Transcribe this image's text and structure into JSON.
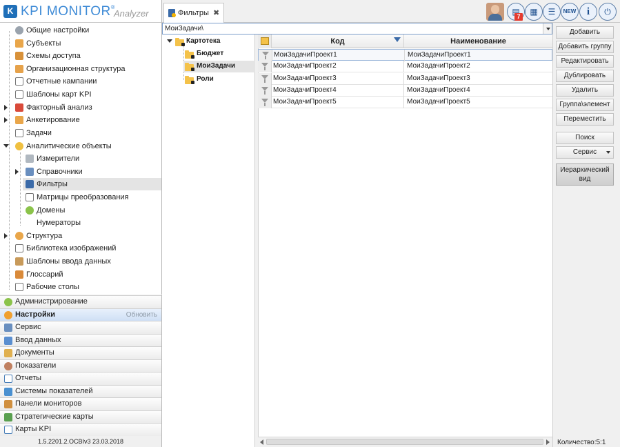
{
  "app": {
    "logo_mark": "K",
    "logo_text": "KPI MONITOR",
    "logo_reg": "®",
    "logo_sub": "Analyzer",
    "version": "1.5.2201.2.OCBIv3  23.03.2018"
  },
  "tabs": [
    {
      "label": "Фильтры",
      "close": "✖"
    }
  ],
  "toolbar": {
    "badge_count": "7",
    "buttons": [
      {
        "icon": "notes-icon",
        "glyph": "▤"
      },
      {
        "icon": "grid-icon",
        "glyph": "▦"
      },
      {
        "icon": "list-icon",
        "glyph": "☰"
      },
      {
        "icon": "new-icon",
        "glyph": "NEW"
      },
      {
        "icon": "info-icon",
        "glyph": "i"
      },
      {
        "icon": "power-icon",
        "glyph": "⏻"
      }
    ]
  },
  "nav": {
    "items": [
      {
        "label": "Общие настройки",
        "icon": "gear-icon"
      },
      {
        "label": "Субъекты",
        "icon": "users-icon"
      },
      {
        "label": "Схемы доступа",
        "icon": "access-icon"
      },
      {
        "label": "Организационная структура",
        "icon": "org-icon"
      },
      {
        "label": "Отчетные кампании",
        "icon": "campaign-icon"
      },
      {
        "label": "Шаблоны карт KPI",
        "icon": "template-icon"
      },
      {
        "label": "Факторный анализ",
        "icon": "factor-icon"
      },
      {
        "label": "Анкетирование",
        "icon": "survey-icon"
      },
      {
        "label": "Задачи",
        "icon": "tasks-icon"
      },
      {
        "label": "Аналитические объекты",
        "icon": "analytics-icon"
      },
      {
        "label": "Измерители",
        "icon": "gauge-icon"
      },
      {
        "label": "Справочники",
        "icon": "reference-icon"
      },
      {
        "label": "Фильтры",
        "icon": "filter-icon"
      },
      {
        "label": "Матрицы преобразования",
        "icon": "matrix-icon"
      },
      {
        "label": "Домены",
        "icon": "domain-icon"
      },
      {
        "label": "Нумераторы",
        "icon": ""
      },
      {
        "label": "Структура",
        "icon": "structure-icon"
      },
      {
        "label": "Библиотека изображений",
        "icon": "images-icon"
      },
      {
        "label": "Шаблоны ввода данных",
        "icon": "input-template-icon"
      },
      {
        "label": "Глоссарий",
        "icon": "glossary-icon"
      },
      {
        "label": "Рабочие столы",
        "icon": "desktop-icon"
      }
    ]
  },
  "sections": [
    {
      "label": "Администрирование",
      "icon": "admin-icon",
      "color": "#8bc34a"
    },
    {
      "label": "Настройки",
      "icon": "settings-icon",
      "color": "#f0a030",
      "active": true,
      "action": "Обновить"
    },
    {
      "label": "Сервис",
      "icon": "service-icon",
      "color": "#6a8fbf"
    },
    {
      "label": "Ввод данных",
      "icon": "data-input-icon",
      "color": "#5b8fd0"
    },
    {
      "label": "Документы",
      "icon": "documents-icon",
      "color": "#e0b050"
    },
    {
      "label": "Показатели",
      "icon": "indicators-icon",
      "color": "#c08060"
    },
    {
      "label": "Отчеты",
      "icon": "reports-icon",
      "color": "#4a7fb8"
    },
    {
      "label": "Системы показателей",
      "icon": "systems-icon",
      "color": "#4a90d0"
    },
    {
      "label": "Панели мониторов",
      "icon": "dashboards-icon",
      "color": "#d09040"
    },
    {
      "label": "Стратегические карты",
      "icon": "strategy-icon",
      "color": "#5aa050"
    },
    {
      "label": "Карты KPI",
      "icon": "kpi-icon",
      "color": "#4a7fb8"
    }
  ],
  "path": {
    "value": "МоиЗадачи\\"
  },
  "tree": {
    "root": "Картотека",
    "children": [
      "Бюджет",
      "МоиЗадачи",
      "Роли"
    ]
  },
  "grid": {
    "columns": [
      "Код",
      "Наименование"
    ],
    "rows": [
      {
        "code": "МоиЗадачиПроект1",
        "name": "МоиЗадачиПроект1"
      },
      {
        "code": "МоиЗадачиПроект2",
        "name": "МоиЗадачиПроект2"
      },
      {
        "code": "МоиЗадачиПроект3",
        "name": "МоиЗадачиПроект3"
      },
      {
        "code": "МоиЗадачиПроект4",
        "name": "МоиЗадачиПроект4"
      },
      {
        "code": "МоиЗадачиПроект5",
        "name": "МоиЗадачиПроект5"
      }
    ]
  },
  "actions": {
    "add": "Добавить",
    "add_group": "Добавить группу",
    "edit": "Редактировать",
    "duplicate": "Дублировать",
    "delete": "Удалить",
    "group_element": "Группа\\элемент",
    "move": "Переместить",
    "search": "Поиск",
    "service": "Сервис",
    "hierarchical": "Иерархический вид"
  },
  "status": {
    "count": "Количество:5:1"
  }
}
